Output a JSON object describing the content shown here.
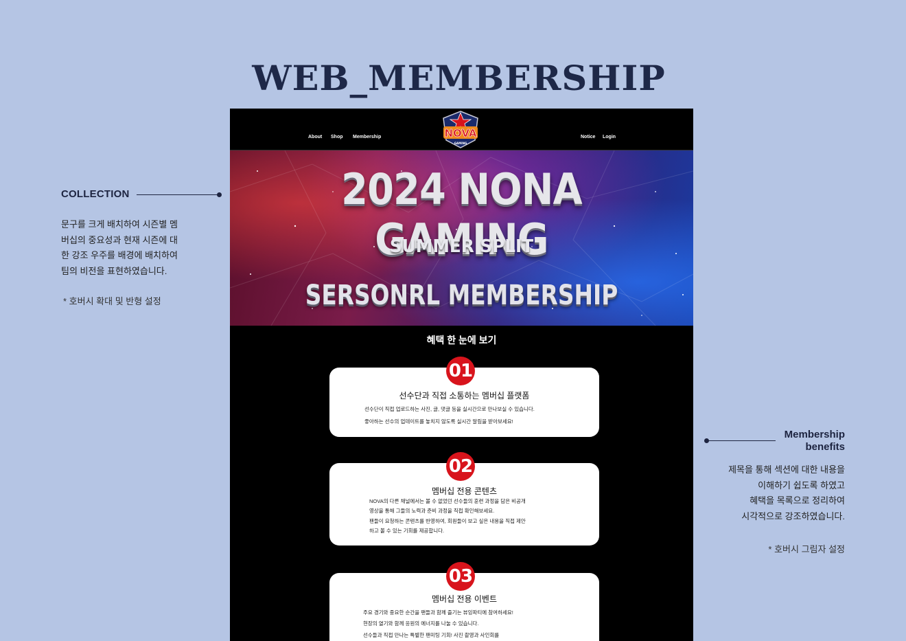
{
  "page": {
    "title": "WEB_MEMBERSHIP"
  },
  "annotation_left": {
    "title": "COLLECTION",
    "description_lines": [
      "문구를 크게 배치하여 시즌별 멤",
      "버십의 중요성과 현재 시즌에 대",
      "한 강조 우주를 배경에 배치하여",
      "팀의 비전을 표현하였습니다."
    ],
    "note": "* 호버시 확대 및 반형 설정"
  },
  "annotation_right": {
    "title_line1": "Membership",
    "title_line2": "benefits",
    "description_lines": [
      "제목을 통해 섹션에 대한 내용을",
      "이해하기 쉽도록 하였고",
      "혜택을 목록으로 정리하여",
      "시각적으로 강조하였습니다."
    ],
    "note": "* 호버시 그림자 설정"
  },
  "site": {
    "nav_left": [
      "About",
      "Shop",
      "Membership"
    ],
    "nav_right": [
      "Notice",
      "Login"
    ],
    "logo_text": "NOVA",
    "logo_badge": "GAMING",
    "colors": {
      "accent_red": "#d8141c",
      "navy": "#1e2848",
      "background": "#b5c5e4"
    }
  },
  "hero": {
    "title": "2024 NONA GAMING",
    "subtitle": "SUMMER SPLIT",
    "membership": "SERSONRL MEMBERSHIP"
  },
  "benefits": {
    "heading": "혜택 한 눈에 보기",
    "items": [
      {
        "number": "01",
        "title": "선수단과 직접 소통하는 멤버십 플랫폼",
        "lines": [
          "선수단이 직접 업로드하는 사진, 글, 댓글 등을 실시간으로 만나보실 수 있습니다.",
          "좋아하는 선수의 업데이트를 놓치지 않도록 실시간 알림을 받아보세요!"
        ]
      },
      {
        "number": "02",
        "title": "멤버십 전용 콘텐츠",
        "lines": [
          "NOVA의 다른 채널에서는 볼 수 없었던 선수들의 훈련 과정을 담은 비공개",
          "영상을 통해 그들의 노력과 준비 과정을 직접 확인해보세요.",
          "팬들이 요청하는 콘텐츠를 반영하여, 회원들이 보고 싶은 내용을 직접 제안",
          "하고 볼 수 있는 기회를 제공합니다."
        ]
      },
      {
        "number": "03",
        "title": "멤버십 전용 이벤트",
        "lines": [
          "주요 경기와 중요한 순간을 팬들과 함께 즐기는 뷰잉파티에 참여하세요!",
          "현장의 열기와 함께 응원의 에너지를 나눌 수 있습니다.",
          "선수들과 직접 만나는 특별한 팬미팅 기회! 사진 촬영과 사인회를"
        ]
      }
    ]
  }
}
